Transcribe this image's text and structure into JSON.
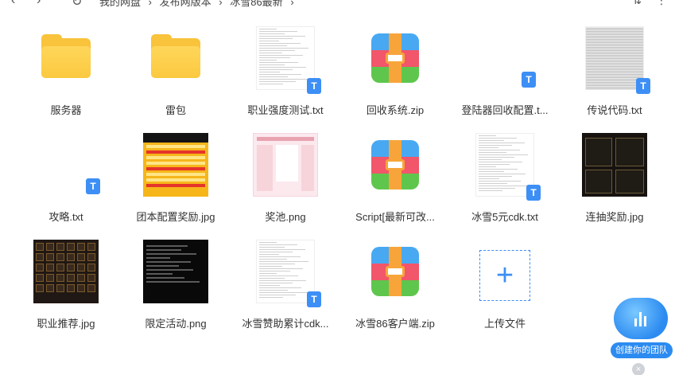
{
  "topbar": {
    "back_glyph": "‹",
    "forward_glyph": "›",
    "up_glyph": "^",
    "refresh_glyph": "↻",
    "breadcrumbs": [
      "我的网盘",
      "›",
      "发布网版本",
      "›",
      "冰雪86最新",
      "›"
    ],
    "sort_glyph": "⇅",
    "more_glyph": "⋮"
  },
  "files": [
    {
      "name": "服务器",
      "kind": "folder"
    },
    {
      "name": "雷包",
      "kind": "folder"
    },
    {
      "name": "职业强度测试.txt",
      "kind": "txt"
    },
    {
      "name": "回收系统.zip",
      "kind": "zip"
    },
    {
      "name": "登陆器回收配置.t...",
      "kind": "txt-blank"
    },
    {
      "name": "传说代码.txt",
      "kind": "txt-dense"
    },
    {
      "name": "攻略.txt",
      "kind": "txt-blank"
    },
    {
      "name": "团本配置奖励.jpg",
      "kind": "img-gold"
    },
    {
      "name": "奖池.png",
      "kind": "img-pink"
    },
    {
      "name": "Script[最新可改...",
      "kind": "zip"
    },
    {
      "name": "冰雪5元cdk.txt",
      "kind": "txt"
    },
    {
      "name": "连抽奖励.jpg",
      "kind": "img-dark"
    },
    {
      "name": "职业推荐.jpg",
      "kind": "img-items"
    },
    {
      "name": "限定活动.png",
      "kind": "img-black"
    },
    {
      "name": "冰雪赞助累计cdk...",
      "kind": "txt"
    },
    {
      "name": "冰雪86客户端.zip",
      "kind": "zip"
    }
  ],
  "upload": {
    "label": "上传文件",
    "glyph": "+"
  },
  "icons": {
    "txt_badge": "T"
  },
  "team_widget": {
    "label": "创建你的团队",
    "close_glyph": "×"
  },
  "colors": {
    "accent": "#3d8ff5",
    "folder": "#f9c33b"
  }
}
